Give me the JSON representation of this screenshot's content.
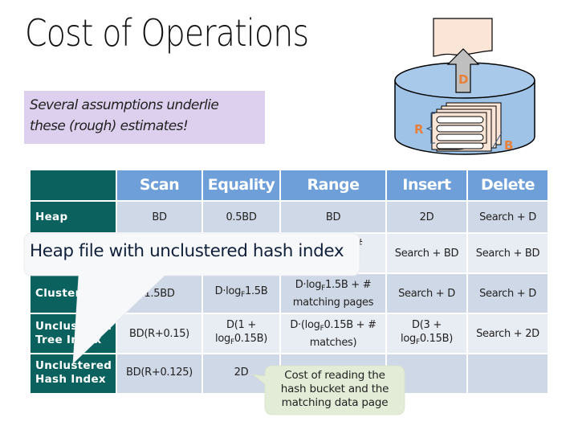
{
  "title": "Cost of Operations",
  "note": {
    "line1": "Several assumptions underlie",
    "line2": "these (rough) estimates!"
  },
  "diagram": {
    "label_d": "D",
    "label_r": "R",
    "label_b": "B",
    "colors": {
      "cylinder": "#9ec3e6",
      "page": "#fbe5d6",
      "arrow": "#bfbfbf",
      "label": "#e8803a"
    }
  },
  "table": {
    "columns": [
      "Scan",
      "Equality",
      "Range",
      "Insert",
      "Delete"
    ],
    "rows": [
      {
        "label": "Heap",
        "cells": [
          "BD",
          "0.5BD",
          "BD",
          "2D",
          "Search + D"
        ]
      },
      {
        "label": "",
        "cells": [
          "",
          "",
          "#",
          "Search + BD",
          "Search + BD"
        ]
      },
      {
        "label": "Clustered",
        "cells": [
          "1.5BD",
          "D·log_F1.5B",
          "D·log_F1.5B + # matching pages",
          "Search + D",
          "Search + D"
        ]
      },
      {
        "label": "Unclustered Tree Index",
        "cells": [
          "BD(R+0.15)",
          "D(1 + log_F0.15B)",
          "D·(log_F0.15B + # matches)",
          "D(3 + log_F0.15B)",
          "Search + 2D"
        ]
      },
      {
        "label": "Unclustered Hash Index",
        "cells": [
          "BD(R+0.125)",
          "2D",
          "",
          "",
          ""
        ]
      }
    ],
    "colors": {
      "header": "#6f9fd8",
      "row_header": "#0b615e",
      "row_odd": "#cfd8e6",
      "row_even": "#e8ecf3"
    }
  },
  "callouts": {
    "heap_hash": "Heap file with unclustered hash index",
    "hash_cost": {
      "line1": "Cost of reading the",
      "line2": "hash bucket and the",
      "line3": "matching data page"
    },
    "colors": {
      "heap_hash_bg": "#f7f8fa",
      "hash_cost_bg": "#e2ecd6"
    }
  }
}
